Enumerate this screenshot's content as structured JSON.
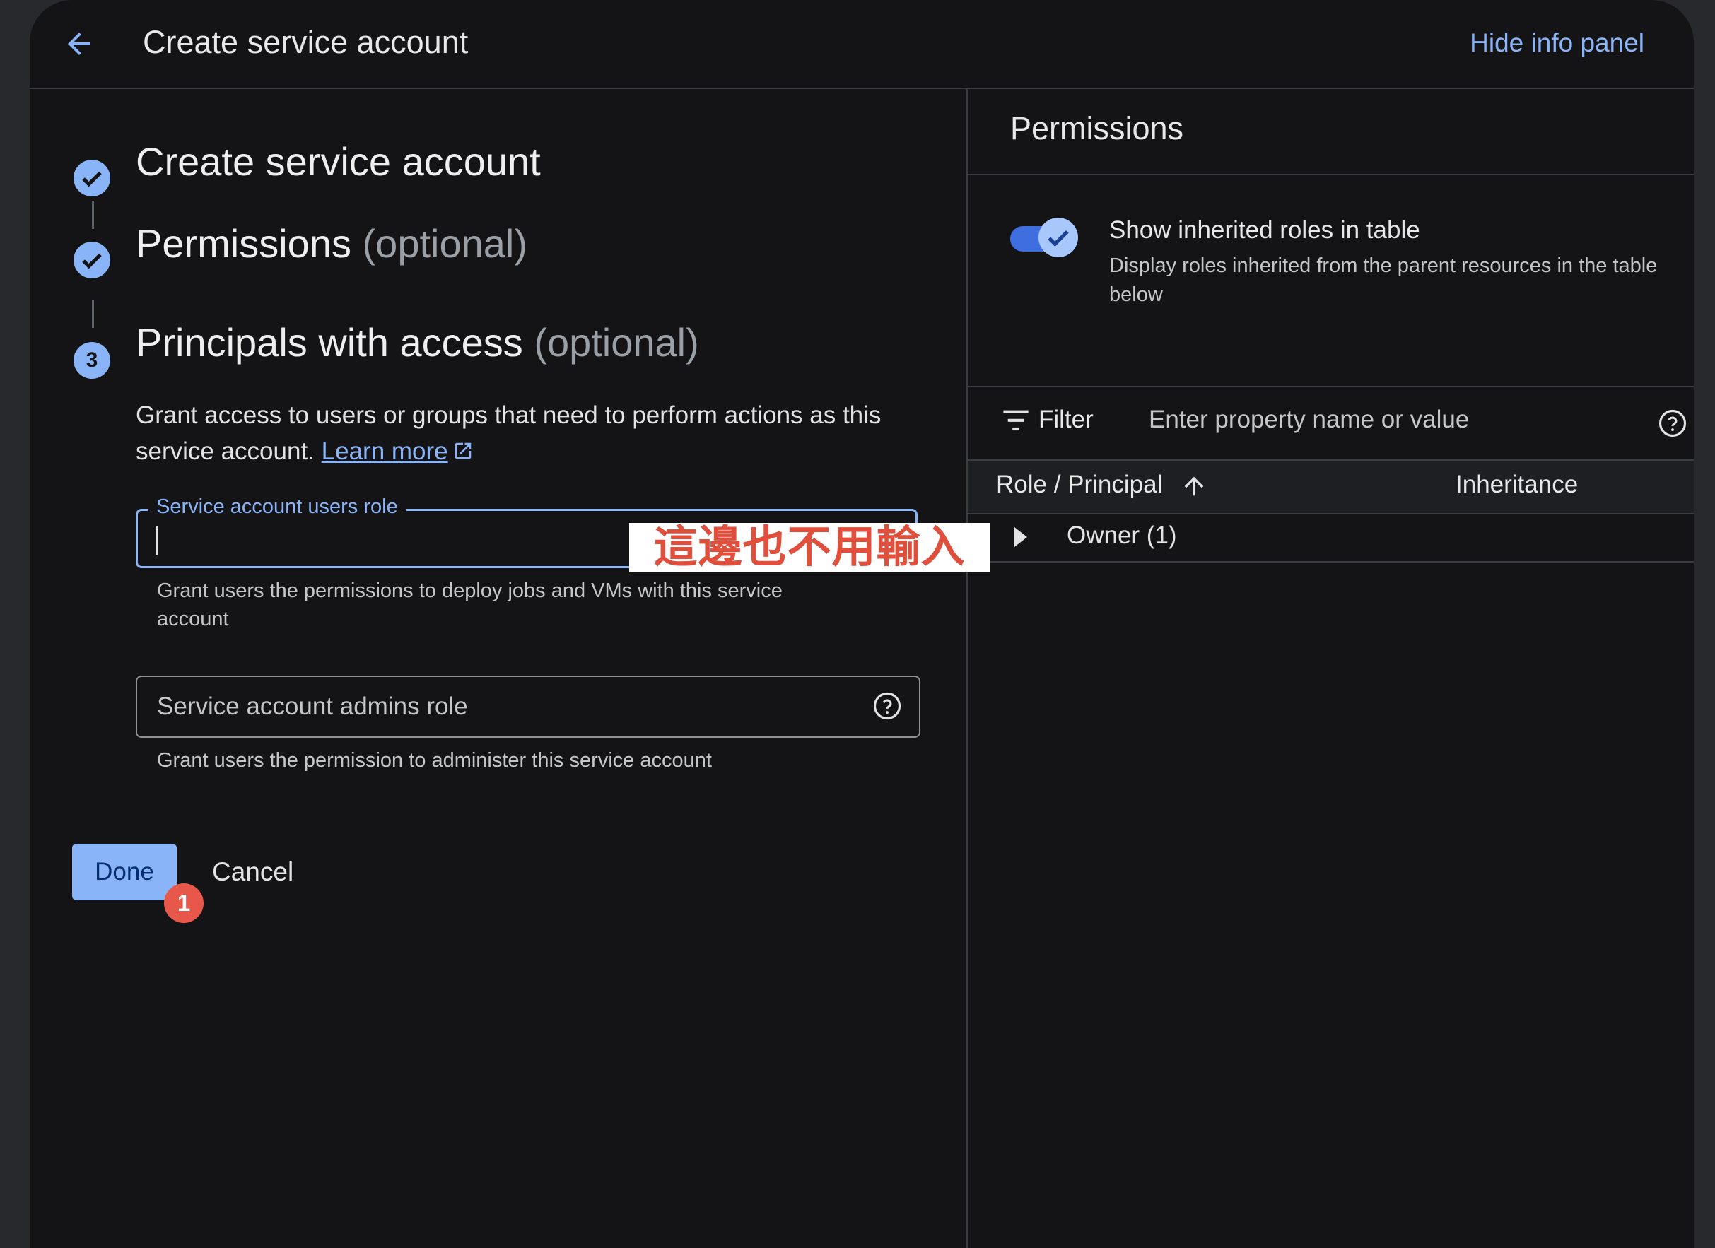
{
  "header": {
    "title": "Create service account",
    "hide_panel": "Hide info panel"
  },
  "steps": [
    {
      "title": "Create service account",
      "suffix": "",
      "status": "completed"
    },
    {
      "title": "Permissions",
      "suffix": "(optional)",
      "status": "completed"
    },
    {
      "title": "Principals with access",
      "suffix": "(optional)",
      "status": "current",
      "number": "3"
    }
  ],
  "step3": {
    "description": "Grant access to users or groups that need to perform actions as this service account.",
    "learn_more": "Learn more",
    "users_role": {
      "label": "Service account users role",
      "value": "",
      "hint": "Grant users the permissions to deploy jobs and VMs with this service account"
    },
    "admins_role": {
      "placeholder": "Service account admins role",
      "hint": "Grant users the permission to administer this service account"
    }
  },
  "actions": {
    "done": "Done",
    "cancel": "Cancel"
  },
  "annotations": {
    "badge": "1",
    "note": "這邊也不用輸入"
  },
  "panel": {
    "title": "Permissions",
    "toggle_label": "Show inherited roles in table",
    "toggle_desc": "Display roles inherited from the parent resources in the table below",
    "toggle_on": true,
    "filter_label": "Filter",
    "filter_placeholder": "Enter property name or value",
    "columns": [
      "Role / Principal",
      "Inheritance"
    ],
    "rows": [
      {
        "label": "Owner (1)"
      }
    ]
  },
  "colors": {
    "accent": "#8ab4f8",
    "background": "#141416",
    "annotation_red": "#e04e3c"
  }
}
